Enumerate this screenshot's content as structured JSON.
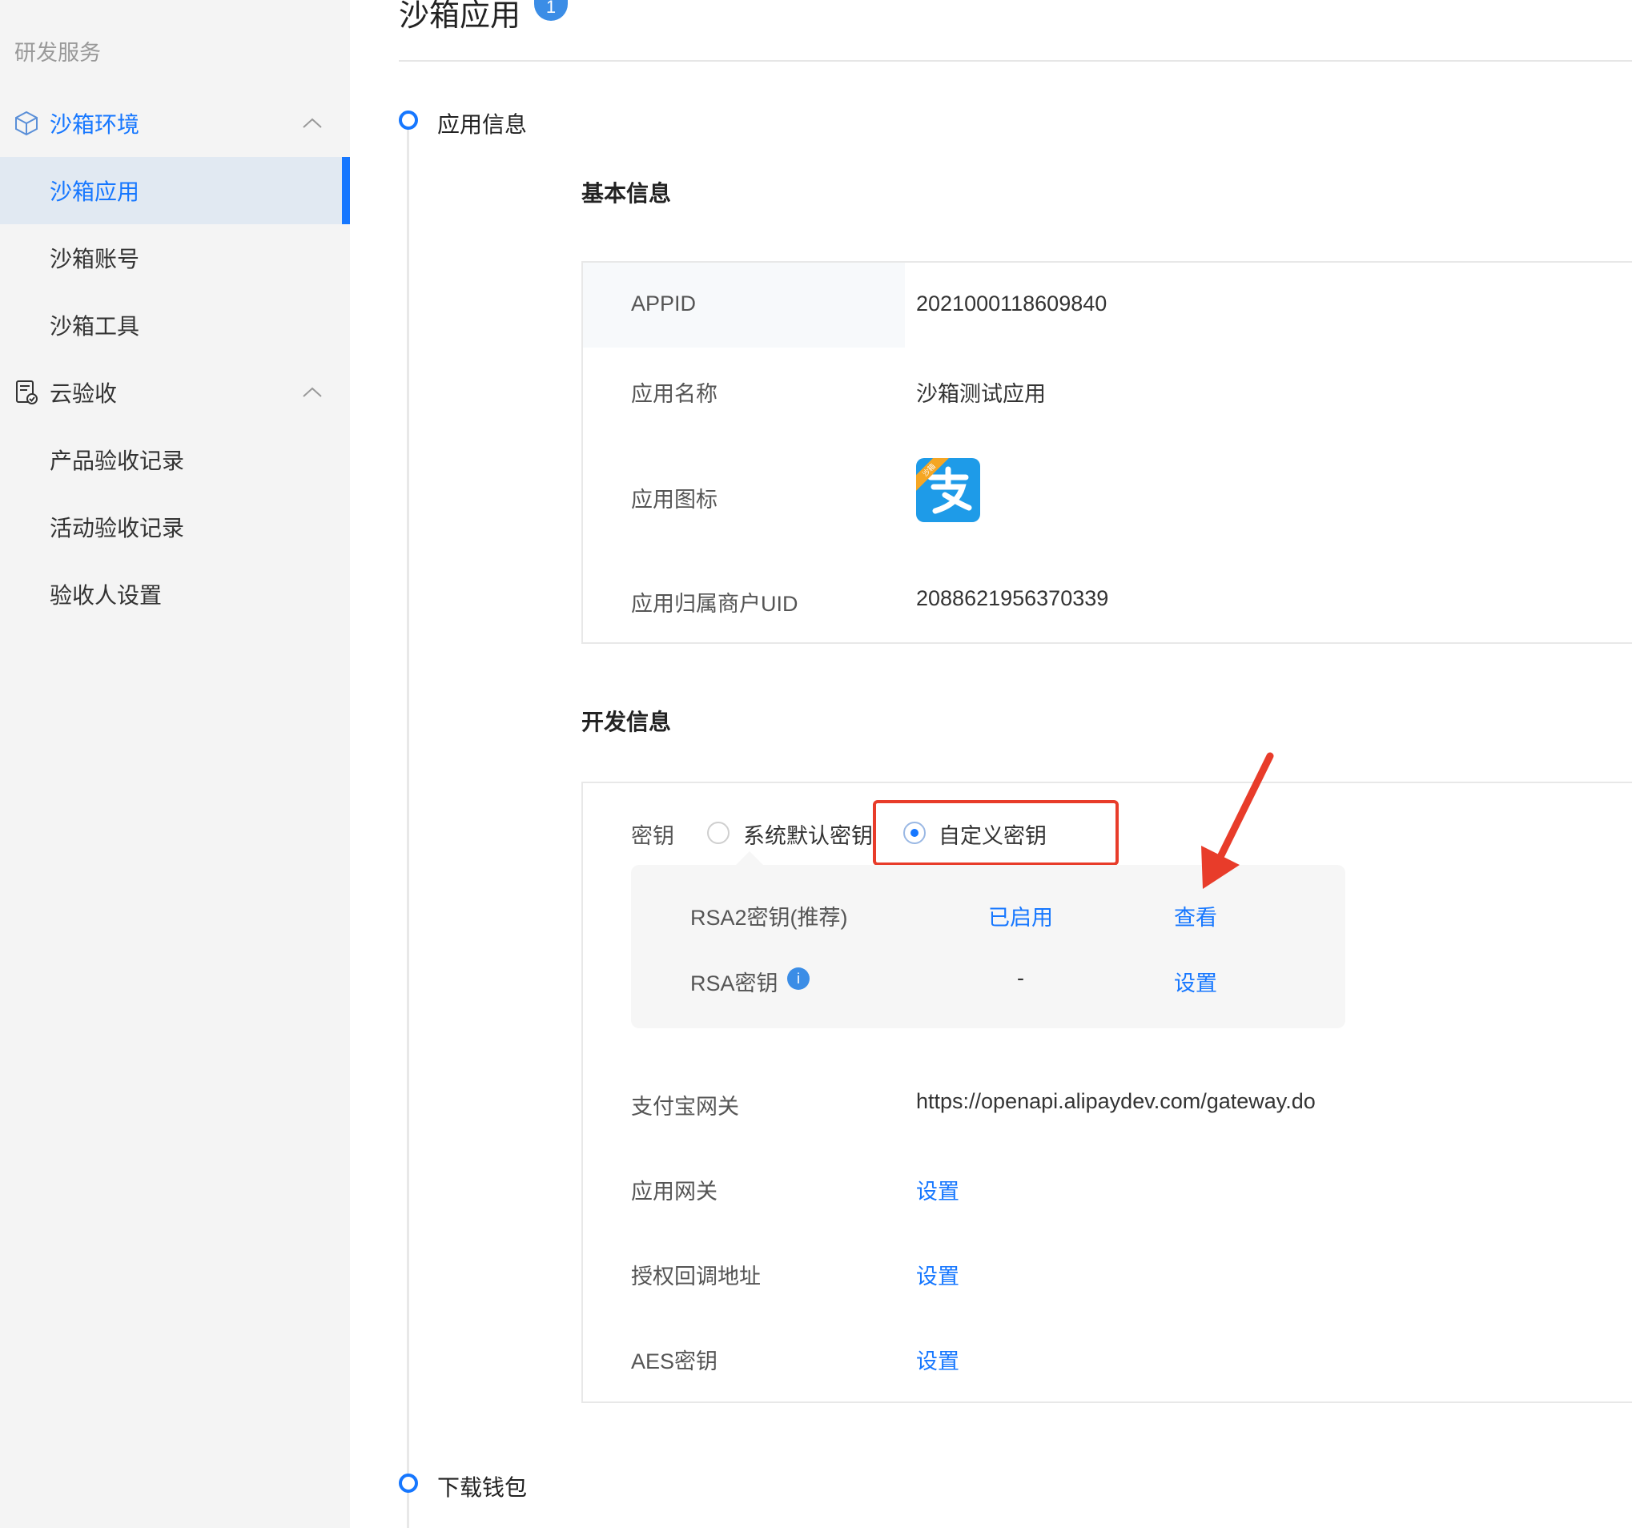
{
  "sidebar": {
    "section": "研发服务",
    "group1": {
      "label": "沙箱环境",
      "icon": "cube-icon"
    },
    "group1_items": [
      "沙箱应用",
      "沙箱账号",
      "沙箱工具"
    ],
    "group2": {
      "label": "云验收",
      "icon": "document-check-icon"
    },
    "group2_items": [
      "产品验收记录",
      "活动验收记录",
      "验收人设置"
    ]
  },
  "page": {
    "title": "沙箱应用",
    "title_badge": "1"
  },
  "timeline": {
    "step1": "应用信息",
    "step2": "下载钱包"
  },
  "basic_info": {
    "title": "基本信息",
    "appid_label": "APPID",
    "appid_value": "2021000118609840",
    "app_name_label": "应用名称",
    "app_name_value": "沙箱测试应用",
    "app_icon_label": "应用图标",
    "app_icon_ribbon": "沙箱",
    "merchant_uid_label": "应用归属商户UID",
    "merchant_uid_value": "2088621956370339"
  },
  "dev_info": {
    "title": "开发信息",
    "key_label": "密钥",
    "radio_default": "系统默认密钥",
    "radio_custom": "自定义密钥",
    "rsa2_label": "RSA2密钥(推荐)",
    "rsa2_status": "已启用",
    "rsa2_action": "查看",
    "rsa_label": "RSA密钥",
    "rsa_info_badge": "i",
    "rsa_status": "-",
    "rsa_action": "设置",
    "gateway_label": "支付宝网关",
    "gateway_value": "https://openapi.alipaydev.com/gateway.do",
    "app_gateway_label": "应用网关",
    "app_gateway_action": "设置",
    "auth_callback_label": "授权回调地址",
    "auth_callback_action": "设置",
    "aes_label": "AES密钥",
    "aes_action": "设置"
  },
  "colors": {
    "accent": "#1677ff",
    "annotation_red": "#e83c2a",
    "alipay_blue": "#1e9be8"
  }
}
